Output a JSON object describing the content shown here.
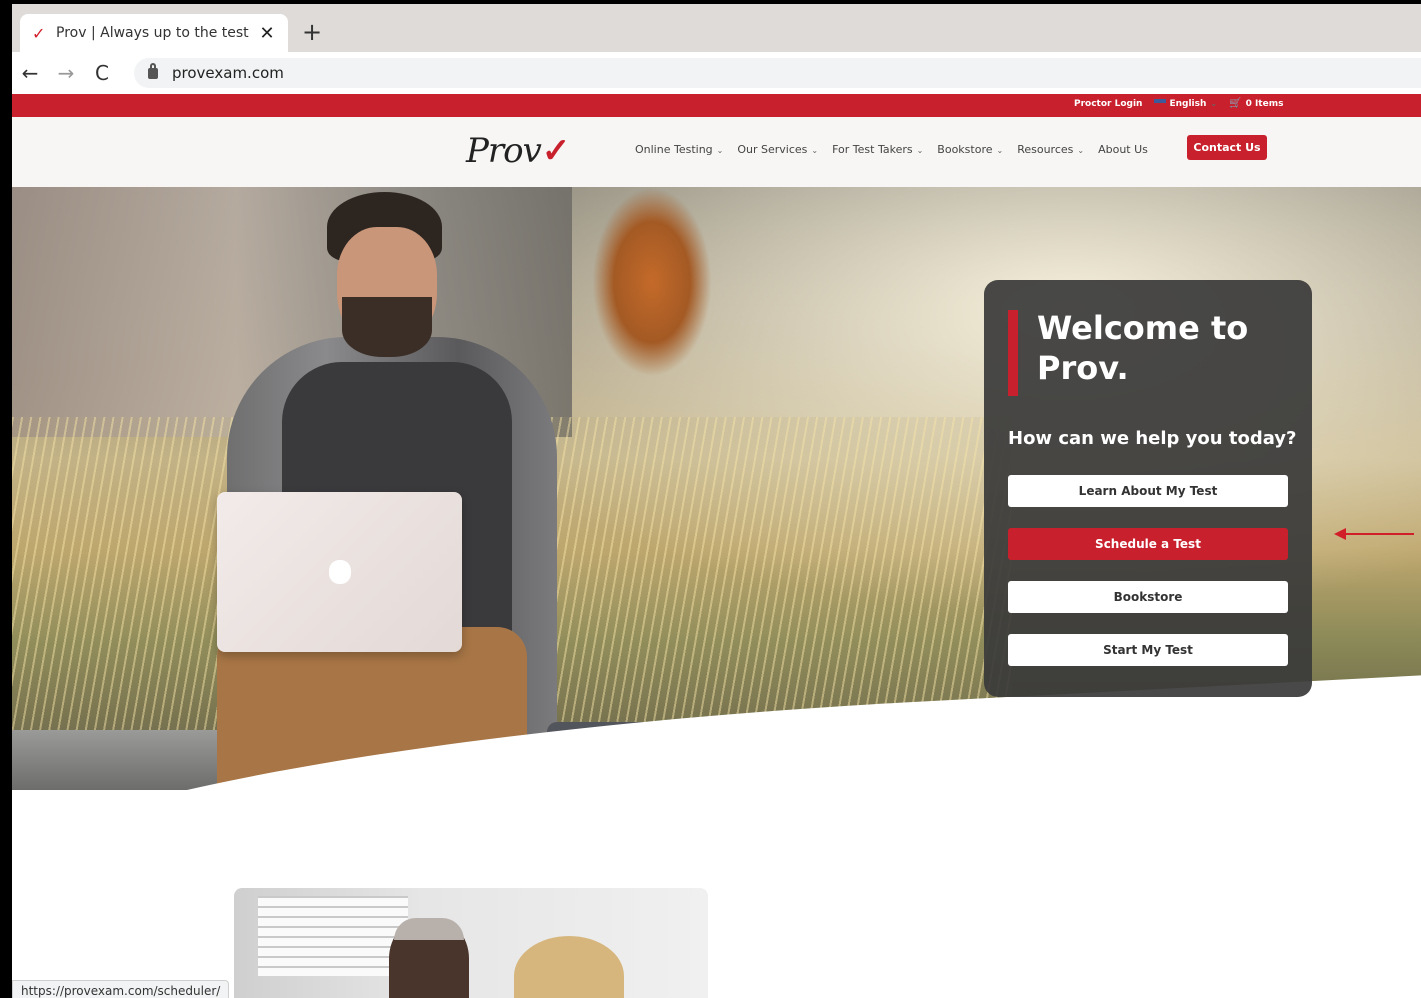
{
  "browser": {
    "tab_title": "Prov | Always up to the test",
    "tab_icon": "checkmark-icon",
    "url": "provexam.com",
    "status_url": "https://provexam.com/scheduler/"
  },
  "topbar": {
    "proctor_login": "Proctor Login",
    "language": "English",
    "cart": "0 Items"
  },
  "header": {
    "logo_text": "Prov",
    "nav": [
      {
        "label": "Online Testing"
      },
      {
        "label": "Our Services"
      },
      {
        "label": "For Test Takers"
      },
      {
        "label": "Bookstore"
      },
      {
        "label": "Resources"
      },
      {
        "label": "About Us"
      }
    ],
    "contact": "Contact Us"
  },
  "welcome": {
    "title": "Welcome to Prov.",
    "subtitle": "How can we help you today?",
    "buttons": [
      {
        "label": "Learn About My Test"
      },
      {
        "label": "Schedule a Test"
      },
      {
        "label": "Bookstore"
      },
      {
        "label": "Start My Test"
      }
    ]
  },
  "colors": {
    "brand_red": "#c8202c",
    "card_bg": "#3a3a3a"
  }
}
